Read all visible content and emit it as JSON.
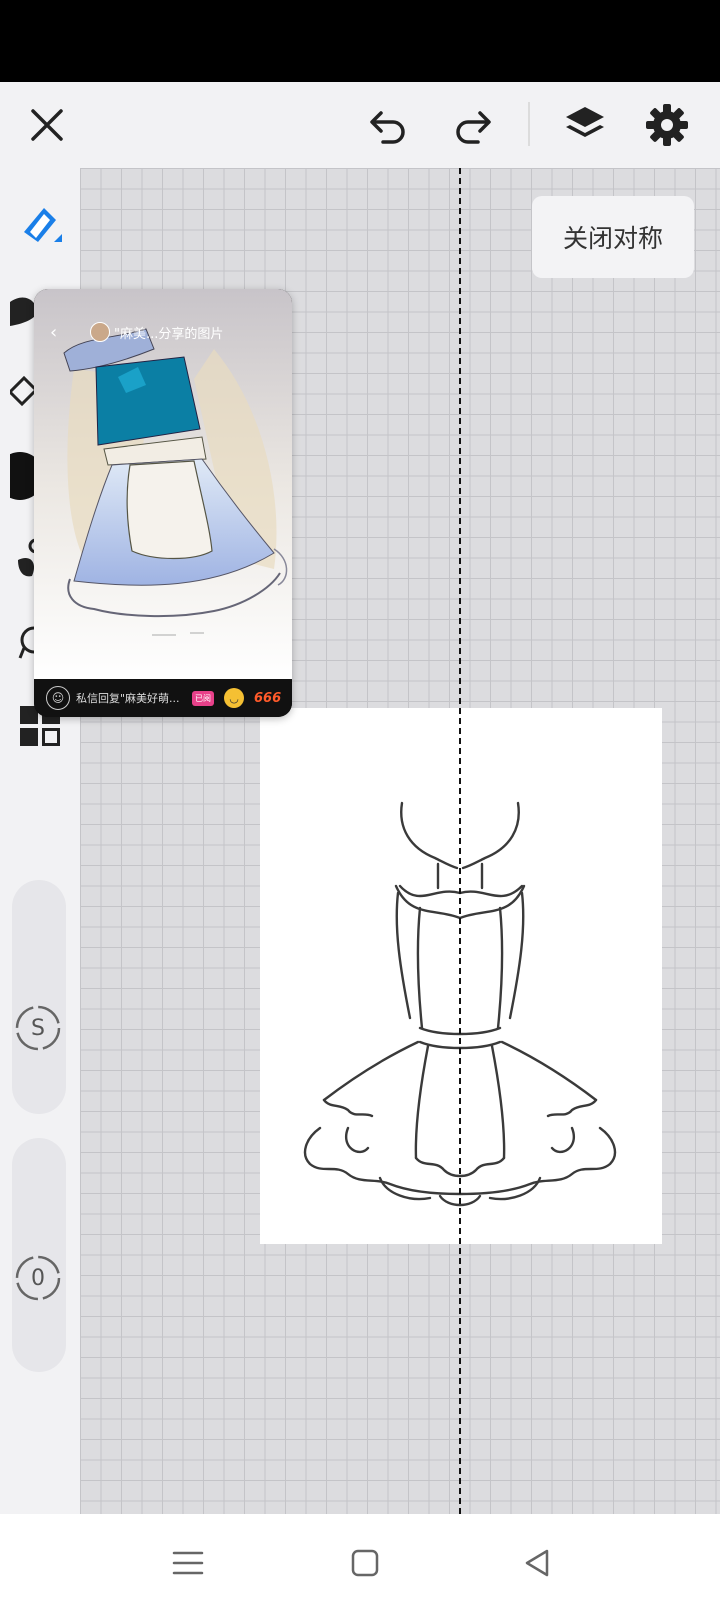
{
  "toolbar": {
    "close_icon": "close-icon",
    "undo_icon": "undo-icon",
    "redo_icon": "redo-icon",
    "layers_icon": "layers-icon",
    "settings_icon": "gear-icon"
  },
  "left_tools": [
    "pen-icon",
    "brush-icon",
    "eraser-icon",
    "color-swatch",
    "smudge-icon",
    "lasso-icon",
    "gallery-icon"
  ],
  "sliders": {
    "size_label": "S",
    "opacity_label": "0"
  },
  "canvas": {
    "symmetry_button_label": "关闭对称"
  },
  "reference": {
    "back_label": "‹",
    "title": "\"麻美...分享的图片",
    "input_placeholder": "私信回复\"麻美好萌...",
    "tag": "已阅",
    "badge": "666"
  },
  "colors": {
    "accent": "#1a7fe8",
    "canvas_grid": "#dcdcdf",
    "top_bar": "#000000"
  }
}
